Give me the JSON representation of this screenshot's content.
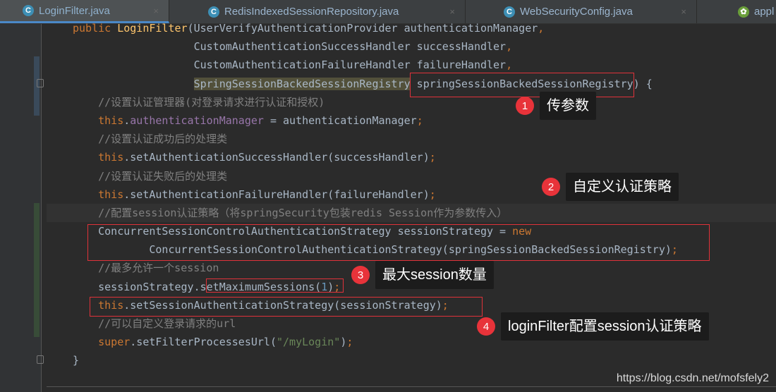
{
  "tabs": [
    {
      "label": "LoginFilter.java",
      "icon": "C",
      "active": true
    },
    {
      "label": "RedisIndexedSessionRepository.java",
      "icon": "C"
    },
    {
      "label": "WebSecurityConfig.java",
      "icon": "C"
    },
    {
      "label": "appl",
      "icon": "spring"
    }
  ],
  "code_lines": [
    [
      [
        "kw",
        "public "
      ],
      [
        "fn",
        "LoginFilter"
      ],
      [
        "",
        "(UserVerifyAuthenticationProvider authenticationManager"
      ],
      [
        "kw",
        ","
      ]
    ],
    [
      [
        "",
        "                   CustomAuthenticationSuccessHandler successHandler"
      ],
      [
        "kw",
        ","
      ]
    ],
    [
      [
        "",
        "                   CustomAuthenticationFailureHandler failureHandler"
      ],
      [
        "kw",
        ","
      ]
    ],
    [
      [
        "",
        "                   "
      ],
      [
        "hl",
        "SpringSessionBackedSessionRegistry"
      ],
      [
        "",
        " springSessionBackedSessionRegistry) {"
      ]
    ],
    [
      [
        "cm",
        "    //设置认证管理器(对登录请求进行认证和授权)"
      ]
    ],
    [
      [
        "kw",
        "    this"
      ],
      [
        "",
        "."
      ],
      [
        "fld",
        "authenticationManager"
      ],
      [
        "",
        " = authenticationManager"
      ],
      [
        "kw",
        ";"
      ]
    ],
    [
      [
        "cm",
        "    //设置认证成功后的处理类"
      ]
    ],
    [
      [
        "kw",
        "    this"
      ],
      [
        "",
        ".setAuthenticationSuccessHandler(successHandler)"
      ],
      [
        "kw",
        ";"
      ]
    ],
    [
      [
        "cm",
        "    //设置认证失败后的处理类"
      ]
    ],
    [
      [
        "kw",
        "    this"
      ],
      [
        "",
        ".setAuthenticationFailureHandler(failureHandler)"
      ],
      [
        "kw",
        ";"
      ]
    ],
    [
      [
        "cm",
        "    //配置session认证策略（将springSecurity包装redis Session作为参数传入）"
      ]
    ],
    [
      [
        "",
        "    ConcurrentSessionControlAuthenticationStrategy sessionStrategy = "
      ],
      [
        "kw",
        "new"
      ]
    ],
    [
      [
        "",
        "            ConcurrentSessionControlAuthenticationStrategy(springSessionBackedSessionRegistry)"
      ],
      [
        "kw",
        ";"
      ]
    ],
    [
      [
        "cm",
        "    //最多允许一个session"
      ]
    ],
    [
      [
        "",
        "    sessionStrategy.setMaximumSessions("
      ],
      [
        "num",
        "1"
      ],
      [
        "",
        ")"
      ],
      [
        "kw",
        ";"
      ]
    ],
    [
      [
        "kw",
        "    this"
      ],
      [
        "",
        ".setSessionAuthenticationStrategy(sessionStrategy)"
      ],
      [
        "kw",
        ";"
      ]
    ],
    [
      [
        "cm",
        "    //可以自定义登录请求的url"
      ]
    ],
    [
      [
        "kw",
        "    super"
      ],
      [
        "",
        ".setFilterProcessesUrl("
      ],
      [
        "str",
        "\"/myLogin\""
      ],
      [
        "",
        ")"
      ],
      [
        "kw",
        ";"
      ]
    ],
    [
      [
        "",
        "}"
      ]
    ]
  ],
  "annotations": [
    {
      "number": "1",
      "text": "传参数"
    },
    {
      "number": "2",
      "text": "自定义认证策略"
    },
    {
      "number": "3",
      "text": "最大session数量"
    },
    {
      "number": "4",
      "text": "loginFilter配置session认证策略"
    }
  ],
  "watermark": "https://blog.csdn.net/mofsfely2"
}
